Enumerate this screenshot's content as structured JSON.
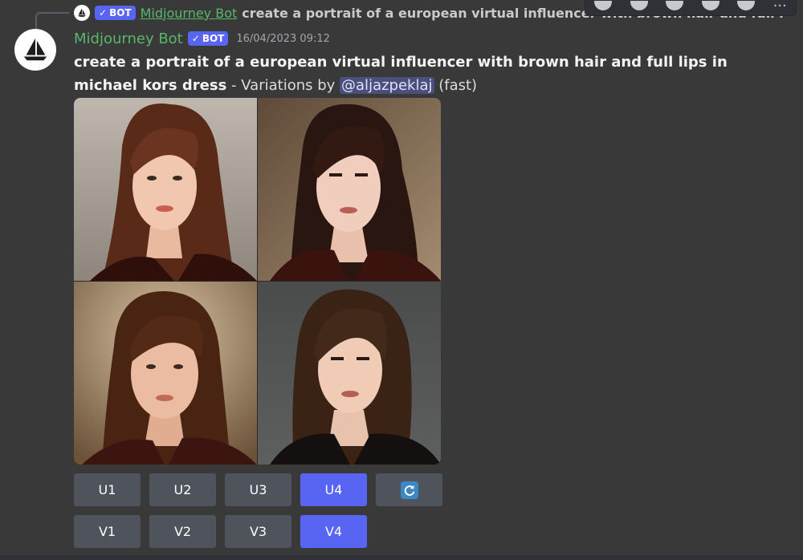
{
  "reply": {
    "bot_badge": "BOT",
    "author": "Midjourney Bot",
    "snippet": "create a portrait of a european virtual influencer with brown hair and full l"
  },
  "message": {
    "author": "Midjourney Bot",
    "bot_badge": "BOT",
    "timestamp": "16/04/2023 09:12",
    "prompt": "create a portrait of a european virtual influencer with brown hair and full lips in michael kors dress",
    "suffix_sep": " - ",
    "variations_by": "Variations by ",
    "mention": "@aljazpeklaj",
    "mode": " (fast)"
  },
  "toolbar": {
    "icons": [
      "link-icon",
      "reply-icon",
      "emoji-icon",
      "thread-icon",
      "forward-icon"
    ],
    "more": "···"
  },
  "buttons": {
    "upscale": [
      {
        "label": "U1",
        "active": false
      },
      {
        "label": "U2",
        "active": false
      },
      {
        "label": "U3",
        "active": false
      },
      {
        "label": "U4",
        "active": true
      }
    ],
    "reroll_icon": "refresh-icon",
    "variation": [
      {
        "label": "V1",
        "active": false
      },
      {
        "label": "V2",
        "active": false
      },
      {
        "label": "V3",
        "active": false
      },
      {
        "label": "V4",
        "active": true
      }
    ]
  },
  "colors": {
    "background": "#393939",
    "username": "#57b86b",
    "blurple": "#5865f2",
    "button": "#4f545c"
  }
}
